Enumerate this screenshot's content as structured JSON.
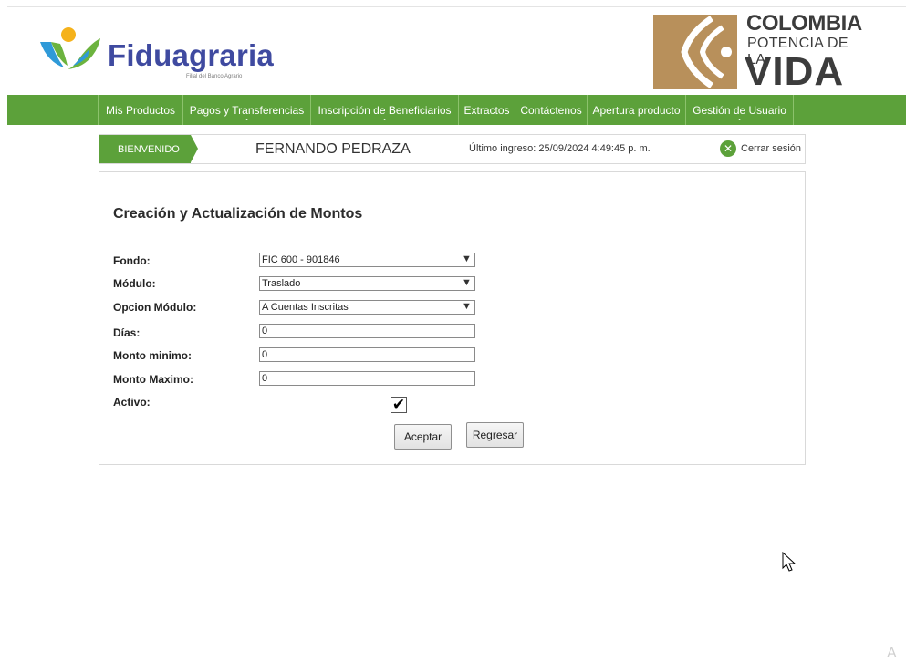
{
  "header": {
    "brand_name": "Fiduagraria",
    "brand_sub": "Filial del Banco Agrario",
    "gov_line1": "COLOMBIA",
    "gov_line2": "POTENCIA DE LA",
    "gov_line3": "VIDA"
  },
  "nav": {
    "items": [
      {
        "label": "Mis Productos"
      },
      {
        "label": "Pagos y Transferencias"
      },
      {
        "label": "Inscripción de Beneficiarios"
      },
      {
        "label": "Extractos"
      },
      {
        "label": "Contáctenos"
      },
      {
        "label": "Apertura producto"
      },
      {
        "label": "Gestión de Usuario"
      }
    ]
  },
  "welcome": {
    "badge": "BIENVENIDO",
    "user_name": "FERNANDO PEDRAZA",
    "last_login": "Último ingreso: 25/09/2024 4:49:45 p. m.",
    "logout": "Cerrar sesión"
  },
  "form": {
    "title": "Creación y Actualización de Montos",
    "fondo": {
      "label": "Fondo:",
      "value": "FIC 600 - 901846"
    },
    "modulo": {
      "label": "Módulo:",
      "value": "Traslado"
    },
    "opcion_modulo": {
      "label": "Opcion Módulo:",
      "value": "A Cuentas Inscritas"
    },
    "dias": {
      "label": "Días:",
      "value": "0"
    },
    "monto_minimo": {
      "label": "Monto minimo:",
      "value": "0"
    },
    "monto_maximo": {
      "label": "Monto Maximo:",
      "value": "0"
    },
    "activo": {
      "label": "Activo:",
      "checked": true
    },
    "accept_label": "Aceptar",
    "back_label": "Regresar"
  },
  "colors": {
    "accent_green": "#5ca13a",
    "brand_blue": "#3f4aa0",
    "gov_gold": "#b8905b"
  }
}
